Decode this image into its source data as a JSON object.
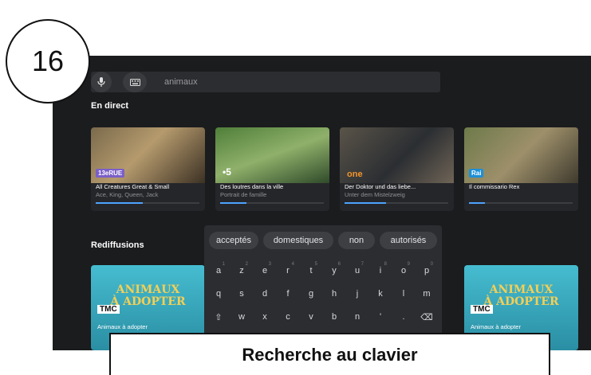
{
  "step_number": "16",
  "search": {
    "query": "animaux"
  },
  "sections": {
    "live": "En direct",
    "replays": "Rediffusions"
  },
  "live_cards": [
    {
      "title": "All Creatures Great & Small",
      "subtitle": "Ace, King, Queen, Jack",
      "channel": "13eRUE",
      "progress": 0.45,
      "accent": "#7b5fc9"
    },
    {
      "title": "Des loutres dans la ville",
      "subtitle": "Portrait de famille",
      "channel": "•5",
      "progress": 0.25,
      "accent": "#2e7d5a"
    },
    {
      "title": "Der Doktor und das liebe...",
      "subtitle": "Unter dem Mistelzweig",
      "channel": "one",
      "progress": 0.4,
      "accent": "#e6892f"
    },
    {
      "title": "Il commissario Rex",
      "subtitle": "",
      "channel": "Rai",
      "progress": 0.15,
      "accent": "#1d8fd6"
    }
  ],
  "replay_cards": [
    {
      "title_line1": "ANIMAUX",
      "title_line2": "À ADOPTER",
      "channel": "TMC",
      "caption": "Animaux à adopter"
    },
    {
      "title_line1": "ANIMAUX",
      "title_line2": "À ADOPTER",
      "channel": "TMC",
      "caption": "Animaux à adopter"
    }
  ],
  "keyboard": {
    "suggestions": [
      "acceptés",
      "domestiques",
      "non",
      "autorisés"
    ],
    "row1": [
      [
        "a",
        "1"
      ],
      [
        "z",
        "2"
      ],
      [
        "e",
        "3"
      ],
      [
        "r",
        "4"
      ],
      [
        "t",
        "5"
      ],
      [
        "y",
        "6"
      ],
      [
        "u",
        "7"
      ],
      [
        "i",
        "8"
      ],
      [
        "o",
        "9"
      ],
      [
        "p",
        "0"
      ]
    ],
    "row2": [
      "q",
      "s",
      "d",
      "f",
      "g",
      "h",
      "j",
      "k",
      "l",
      "m"
    ],
    "row3": [
      "⇧",
      "w",
      "x",
      "c",
      "v",
      "b",
      "n",
      "'",
      ".",
      "⌫"
    ]
  },
  "caption": "Recherche au clavier",
  "colors": {
    "background": "#1b1c1e",
    "progress": "#4da3ff",
    "keyboard": "#2c2d31"
  },
  "icons": [
    "microphone-icon",
    "keyboard-icon",
    "shift-icon",
    "backspace-icon"
  ]
}
